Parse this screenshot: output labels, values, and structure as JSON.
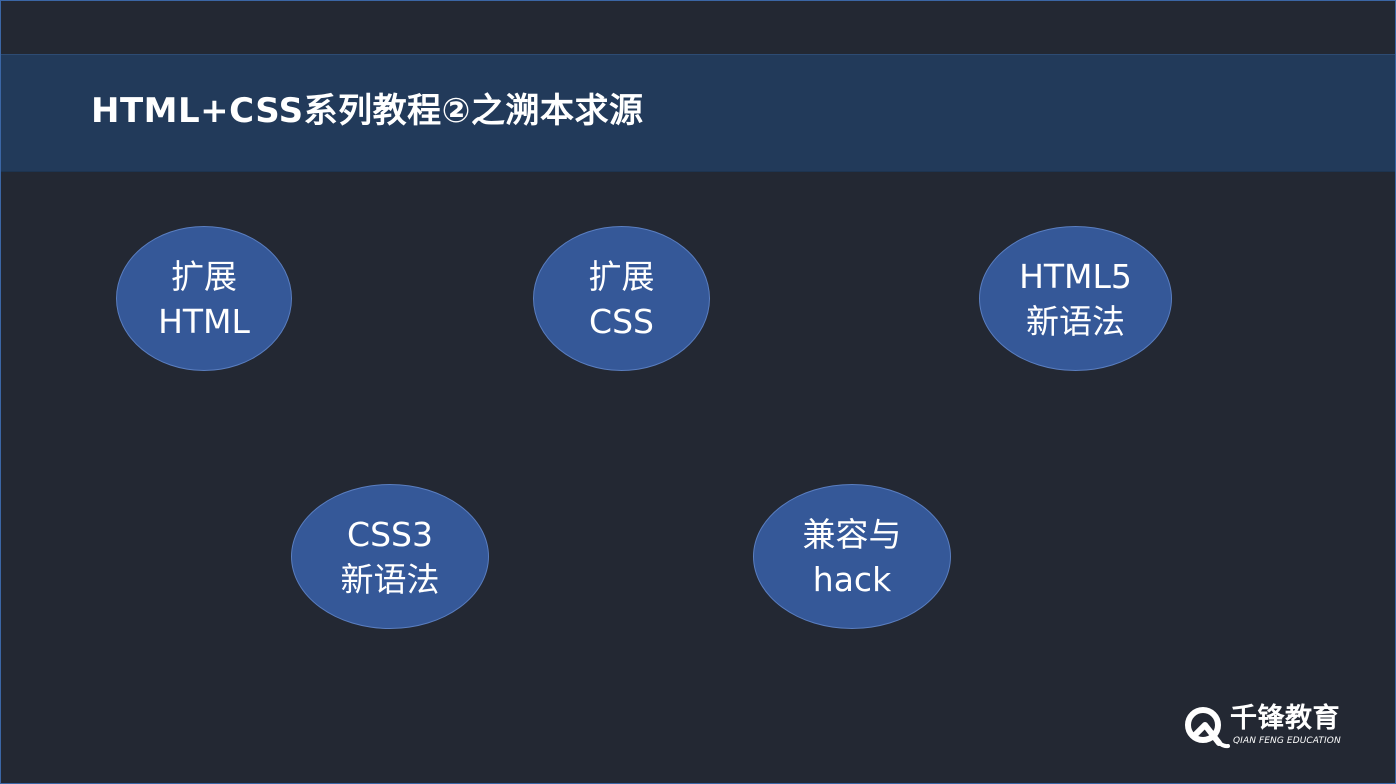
{
  "slide": {
    "title": "HTML+CSS系列教程②之溯本求源",
    "bubbles": [
      {
        "line1": "扩展",
        "line2": "HTML"
      },
      {
        "line1": "扩展",
        "line2": "CSS"
      },
      {
        "line1": "HTML5",
        "line2": "新语法"
      },
      {
        "line1": "CSS3",
        "line2": "新语法"
      },
      {
        "line1": "兼容与",
        "line2": "hack"
      }
    ]
  },
  "logo": {
    "name": "千锋教育",
    "subtitle": "QIAN FENG EDUCATION",
    "icon": "qianfeng-logo-icon"
  },
  "colors": {
    "background": "#232833",
    "title_band": "#223a5a",
    "bubble_fill": "#355898",
    "text": "#ffffff"
  }
}
